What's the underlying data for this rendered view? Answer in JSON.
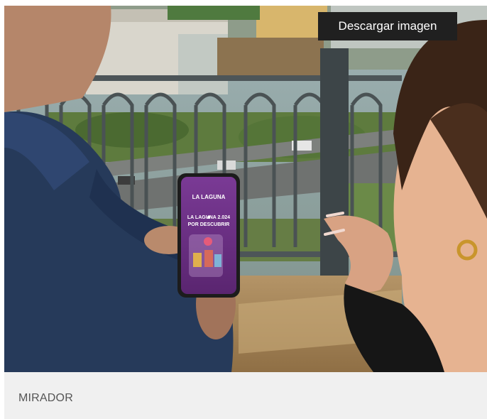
{
  "photo": {
    "alt_subject": "",
    "phone_screen": {
      "line1": "LA LAGUNA",
      "line2": "LA LAGUNA 2.024",
      "line3": "POR DESCUBRIR"
    }
  },
  "actions": {
    "download_label": "Descargar imagen"
  },
  "caption": {
    "text": "MIRADOR"
  },
  "colors": {
    "button_bg": "#202020",
    "caption_bg": "#f0f0f0",
    "caption_text": "#555555",
    "phone_screen": "#6b2f86"
  }
}
